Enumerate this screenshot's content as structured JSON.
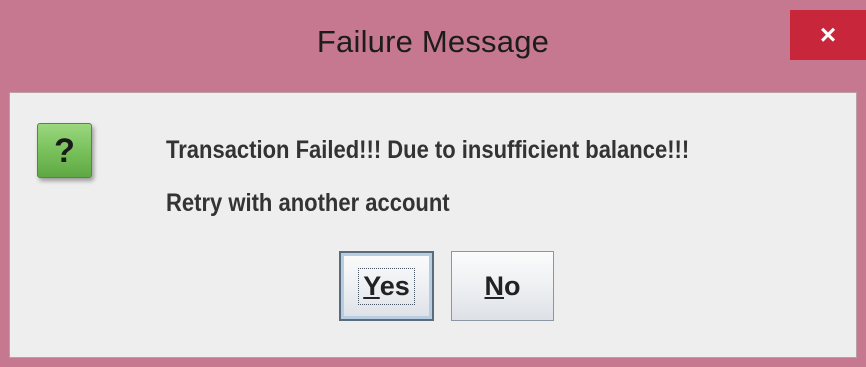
{
  "dialog": {
    "title": "Failure Message",
    "close_glyph": "×",
    "icon": "question-icon",
    "icon_glyph": "?",
    "message_line1": "Transaction Failed!!! Due to insufficient balance!!!",
    "message_line2": "Retry with another account",
    "buttons": {
      "yes": {
        "mnemonic": "Y",
        "rest": "es"
      },
      "no": {
        "mnemonic": "N",
        "rest": "o"
      }
    }
  },
  "colors": {
    "titlebar": "#c5788f",
    "close_button": "#c7263b",
    "content_background": "#eeeeee",
    "icon_green": "#76bf58"
  }
}
